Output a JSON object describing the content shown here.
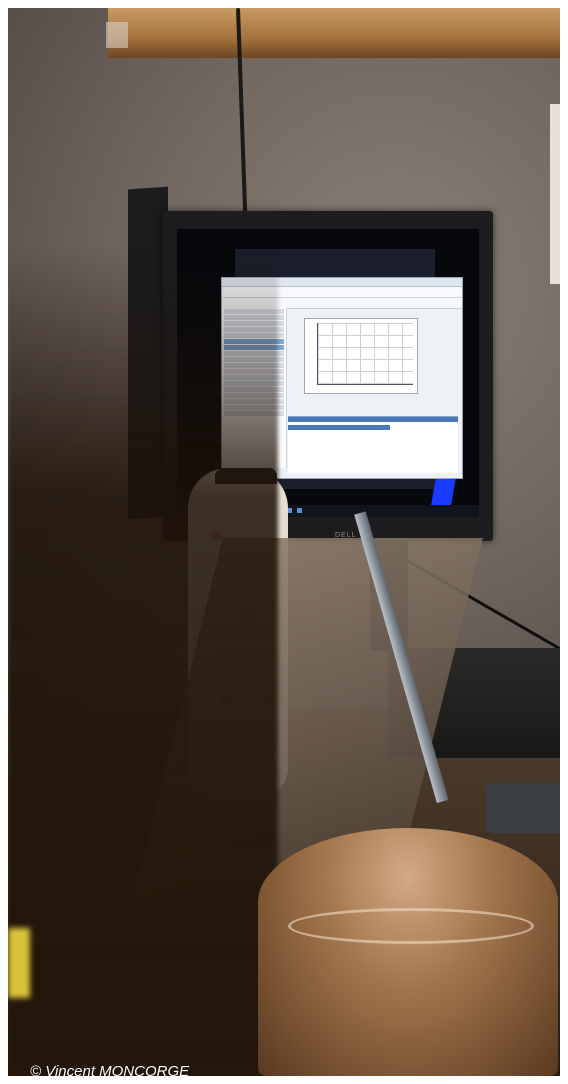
{
  "photo": {
    "credit": "© Vincent MONCORGE",
    "monitor_brand": "DELL",
    "colors": {
      "wall": "#736861",
      "shelf_wood": "#a5733e",
      "monitor_bezel": "#1d1d20",
      "screen_window": "#eef1f6",
      "accent_blue": "#1a3cff"
    }
  }
}
